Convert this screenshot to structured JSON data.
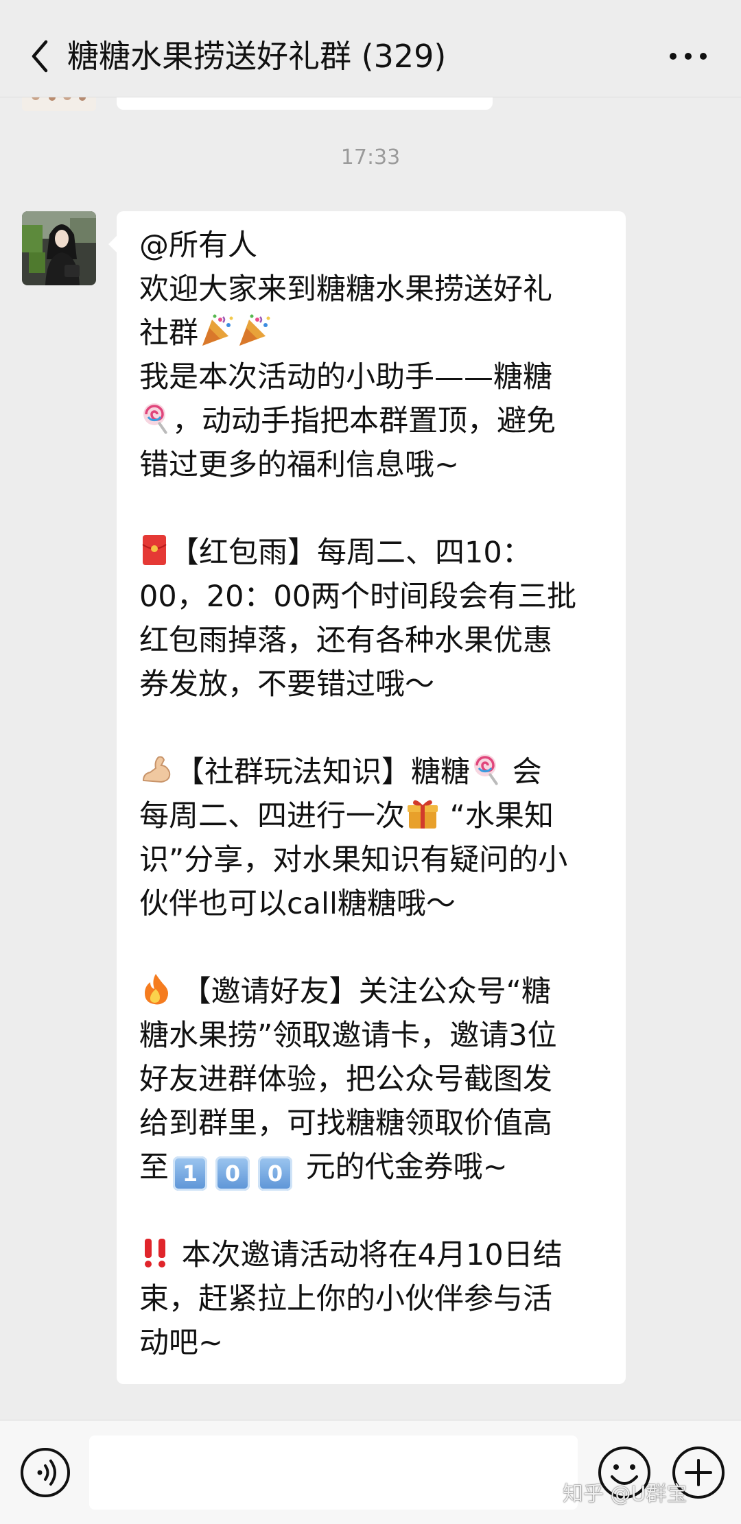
{
  "header": {
    "title": "糖糖水果捞送好礼群 (329)"
  },
  "chat": {
    "timestamp": "17:33",
    "message": {
      "mention": "@所有人",
      "welcome_1": "欢迎大家来到糖糖水果捞送好礼",
      "welcome_2": "社群",
      "intro_1": "我是本次活动的小助手——糖糖",
      "intro_2": "，动动手指把本群置顶，避免",
      "intro_3": "错过更多的福利信息哦~",
      "redpacket_1": "【红包雨】每周二、四10：",
      "redpacket_2": "00，20：00两个时间段会有三批",
      "redpacket_3": "红包雨掉落，还有各种水果优惠",
      "redpacket_4": "券发放，不要错过哦～",
      "knowledge_1a": "【社群玩法知识】糖糖",
      "knowledge_1b": " 会",
      "knowledge_2a": "每周二、四进行一次",
      "knowledge_2b": " “水果知",
      "knowledge_3": "识”分享，对水果知识有疑问的小",
      "knowledge_4": "伙伴也可以call糖糖哦～",
      "invite_1": " 【邀请好友】关注公众号“糖",
      "invite_2": "糖水果捞”领取邀请卡，邀请3位",
      "invite_3": "好友进群体验，把公众号截图发",
      "invite_4": "给到群里，可找糖糖领取价值高",
      "invite_5a": "至",
      "invite_keycaps": [
        "1",
        "0",
        "0"
      ],
      "invite_5b": " 元的代金券哦~",
      "end_1": " 本次邀请活动将在4月10日结",
      "end_2": "束，赶紧拉上你的小伙伴参与活",
      "end_3": "动吧~"
    }
  },
  "input_bar": {
    "placeholder": ""
  },
  "watermark": "知乎 @U群宝",
  "icons": {
    "back": "chevron-left-icon",
    "more": "more-dots-icon",
    "voice": "voice-icon",
    "emoji": "smiley-icon",
    "plus": "plus-icon",
    "party": "party-popper-icon",
    "lollipop": "lollipop-icon",
    "red_envelope": "red-envelope-icon",
    "muscle": "flexed-biceps-icon",
    "gift": "gift-icon",
    "fire": "fire-icon",
    "alert": "double-exclamation-icon"
  },
  "colors": {
    "background": "#ededed",
    "bubble": "#ffffff",
    "text": "#111111",
    "timestamp": "#9a9a9a"
  }
}
